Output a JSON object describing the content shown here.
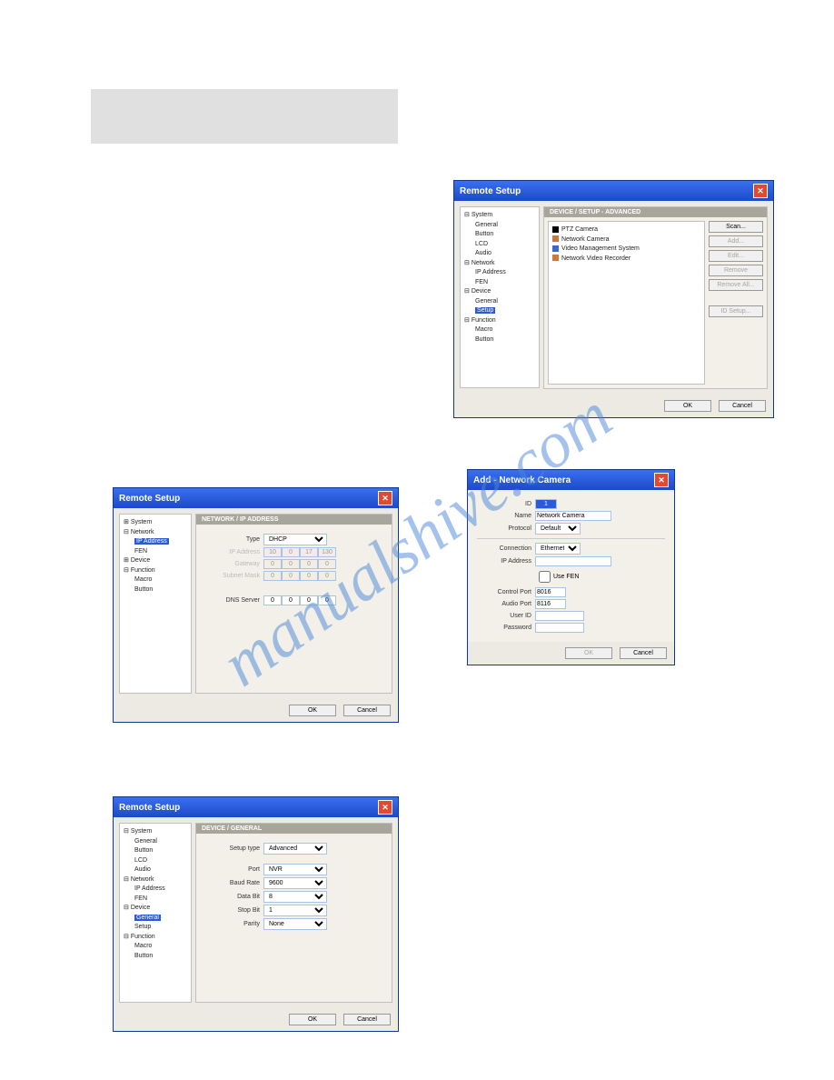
{
  "watermark": "manualshive.com",
  "win1": {
    "title": "Remote Setup",
    "tree": {
      "system": "System",
      "system_items": [
        "General",
        "Button",
        "LCD",
        "Audio"
      ],
      "network": "Network",
      "network_items": [
        "IP Address",
        "FEN"
      ],
      "device": "Device",
      "device_items": [
        "General",
        "Setup"
      ],
      "function": "Function",
      "function_items": [
        "Macro",
        "Button"
      ]
    },
    "panel_title": "DEVICE / SETUP - ADVANCED",
    "device_types": [
      "PTZ Camera",
      "Network Camera",
      "Video Management System",
      "Network Video Recorder"
    ],
    "buttons": {
      "scan": "Scan...",
      "add": "Add...",
      "edit": "Edit...",
      "remove": "Remove",
      "remove_all": "Remove All...",
      "id_setup": "ID Setup..."
    },
    "ok": "OK",
    "cancel": "Cancel"
  },
  "win2": {
    "title": "Remote Setup",
    "tree": {
      "system": "System",
      "network": "Network",
      "ip": "IP Address",
      "fen": "FEN",
      "device": "Device",
      "function": "Function",
      "macro": "Macro",
      "button": "Button"
    },
    "panel_title": "NETWORK / IP ADDRESS",
    "labels": {
      "type": "Type",
      "ip": "IP Address",
      "gw": "Gateway",
      "mask": "Subnet Mask",
      "dns": "DNS Server"
    },
    "values": {
      "type": "DHCP",
      "ip": [
        "10",
        "0",
        "17",
        "130"
      ],
      "gw": [
        "0",
        "0",
        "0",
        "0"
      ],
      "mask": [
        "0",
        "0",
        "0",
        "0"
      ],
      "dns": [
        "0",
        "0",
        "0",
        "0"
      ]
    },
    "ok": "OK",
    "cancel": "Cancel"
  },
  "win3": {
    "title": "Add - Network Camera",
    "labels": {
      "id": "ID",
      "name": "Name",
      "protocol": "Protocol",
      "conn": "Connection",
      "ip": "IP Address",
      "usefen": "Use FEN",
      "cport": "Control Port",
      "aport": "Audio Port",
      "uid": "User ID",
      "pwd": "Password"
    },
    "values": {
      "id": "1",
      "name": "Network Camera",
      "protocol": "Default",
      "conn": "Ethernet",
      "cport": "8016",
      "aport": "8116"
    },
    "ok": "OK",
    "cancel": "Cancel"
  },
  "win4": {
    "title": "Remote Setup",
    "tree": {
      "system": "System",
      "general": "General",
      "button": "Button",
      "lcd": "LCD",
      "audio": "Audio",
      "network": "Network",
      "ip": "IP Address",
      "fen": "FEN",
      "device": "Device",
      "dgeneral": "General",
      "setup": "Setup",
      "function": "Function",
      "macro": "Macro",
      "fbutton": "Button"
    },
    "panel_title": "DEVICE / GENERAL",
    "labels": {
      "stype": "Setup type",
      "port": "Port",
      "baud": "Baud Rate",
      "dbit": "Data Bit",
      "sbit": "Stop Bit",
      "parity": "Parity"
    },
    "values": {
      "stype": "Advanced",
      "port": "NVR",
      "baud": "9600",
      "dbit": "8",
      "sbit": "1",
      "parity": "None"
    },
    "ok": "OK",
    "cancel": "Cancel"
  }
}
